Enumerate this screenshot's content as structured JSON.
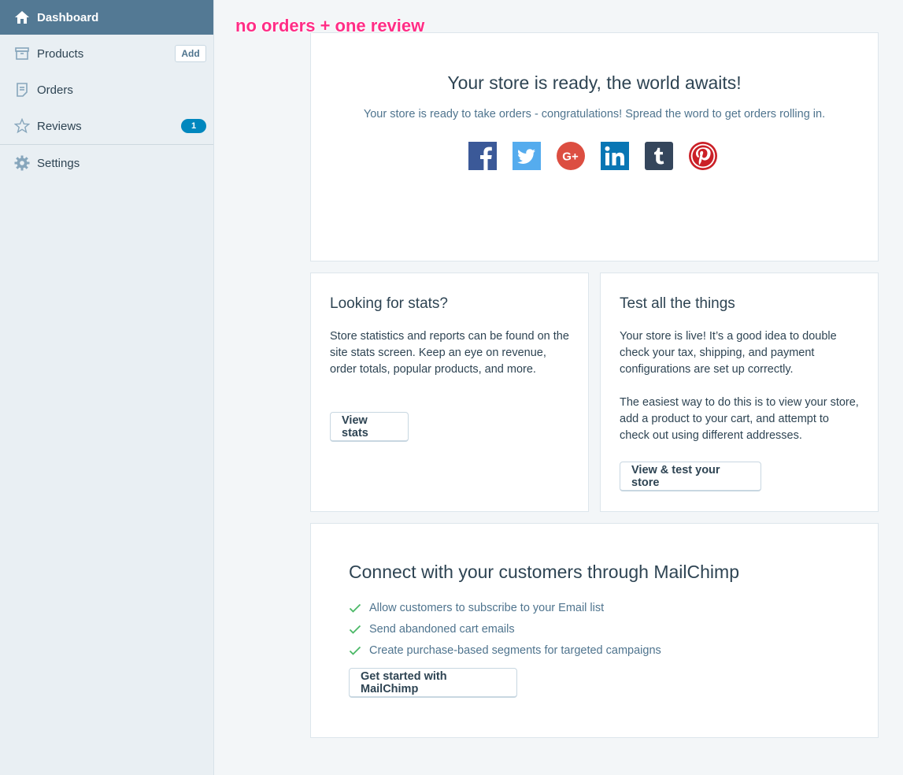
{
  "annotation": "no orders + one review",
  "sidebar": {
    "items": [
      {
        "label": "Dashboard",
        "icon": "house-icon"
      },
      {
        "label": "Products",
        "icon": "archive-box-icon",
        "action": "Add"
      },
      {
        "label": "Orders",
        "icon": "document-icon"
      },
      {
        "label": "Reviews",
        "icon": "star-icon",
        "badge": "1"
      },
      {
        "label": "Settings",
        "icon": "gear-icon"
      }
    ]
  },
  "hero": {
    "title": "Your store is ready, the world awaits!",
    "subtitle": "Your store is ready to take orders - congratulations! Spread the word to get orders rolling in.",
    "social": [
      "facebook-icon",
      "twitter-icon",
      "google-plus-icon",
      "linkedin-icon",
      "tumblr-icon",
      "pinterest-icon"
    ]
  },
  "stats_card": {
    "title": "Looking for stats?",
    "body": "Store statistics and reports can be found on the site stats screen. Keep an eye on revenue, order totals, popular products, and more.",
    "button": "View stats"
  },
  "test_card": {
    "title": "Test all the things",
    "body1": "Your store is live! It’s a good idea to double check your tax, shipping, and payment configurations are set up correctly.",
    "body2": "The easiest way to do this is to view your store, add a product to your cart, and attempt to check out using different addresses.",
    "button": "View & test your store"
  },
  "mailchimp": {
    "title": "Connect with your customers through MailChimp",
    "features": [
      "Allow customers to subscribe to your Email list",
      "Send abandoned cart emails",
      "Create purchase-based segments for targeted campaigns"
    ],
    "button": "Get started with MailChimp"
  },
  "colors": {
    "accent": "#537994",
    "badge": "#0087be",
    "annotation": "#ff2d86",
    "check": "#4ab866"
  }
}
